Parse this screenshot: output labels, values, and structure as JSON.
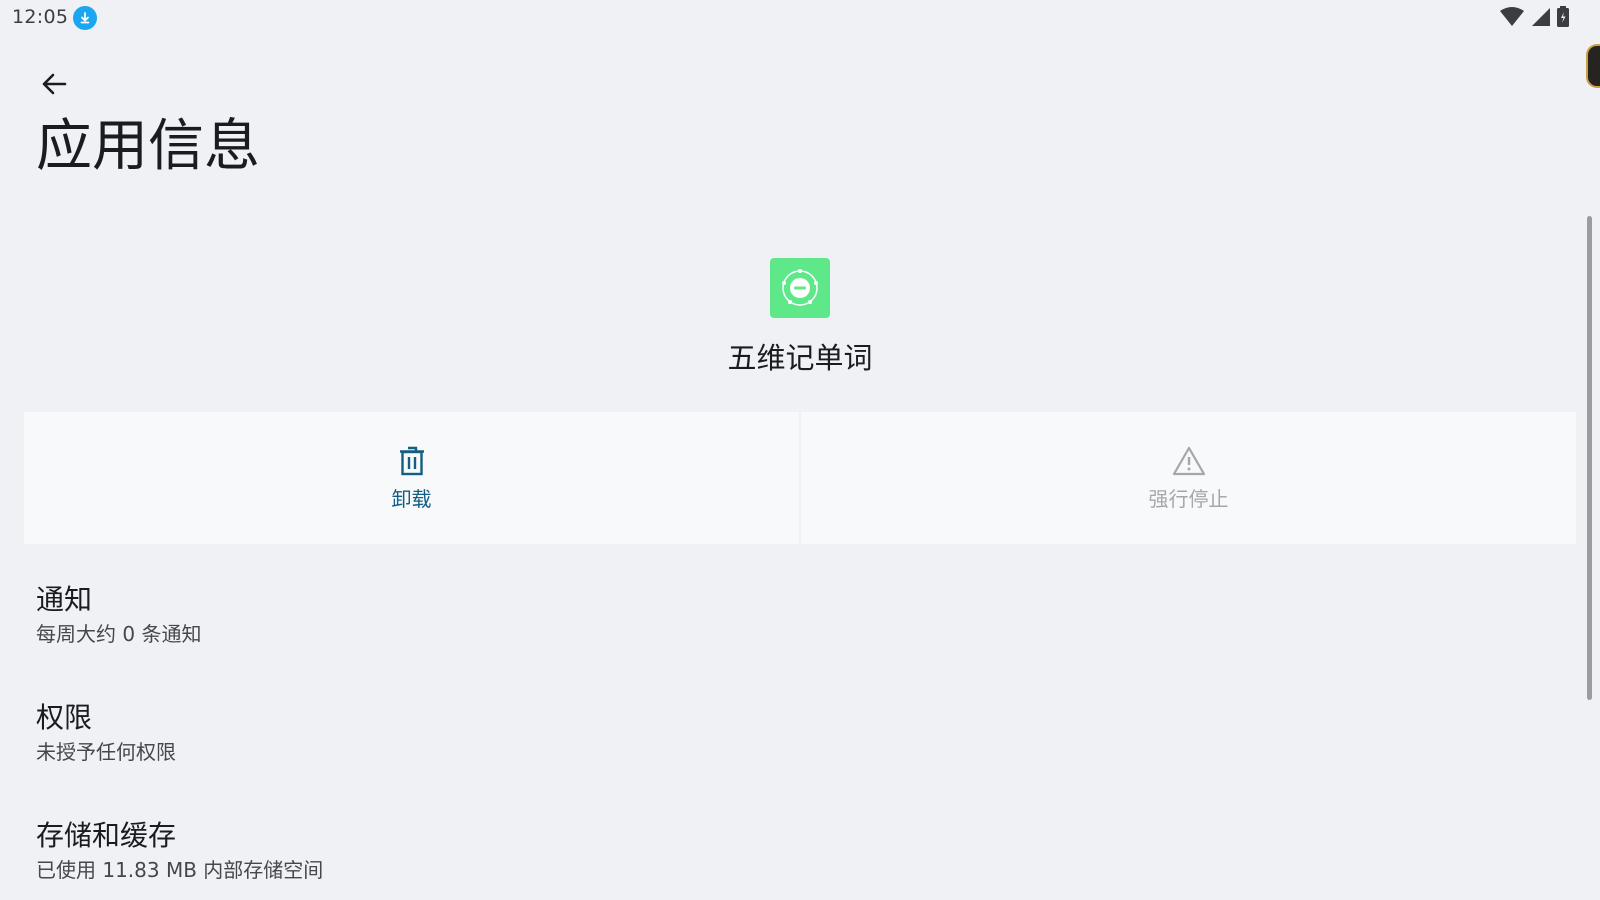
{
  "status_bar": {
    "time": "12:05",
    "icons": [
      "download-icon",
      "wifi-icon",
      "signal-icon",
      "battery-charging-icon"
    ]
  },
  "header": {
    "back_icon": "arrow-left-icon",
    "title": "应用信息"
  },
  "app": {
    "name": "五维记单词",
    "icon": "app-logo-icon",
    "icon_color": "#5fe88a"
  },
  "actions": {
    "uninstall": {
      "label": "卸载",
      "icon": "trash-icon",
      "color": "#135e83",
      "enabled": true
    },
    "force_stop": {
      "label": "强行停止",
      "icon": "warning-icon",
      "color": "#a4a7ab",
      "enabled": false
    }
  },
  "settings": {
    "notifications": {
      "title": "通知",
      "summary": "每周大约 0 条通知"
    },
    "permissions": {
      "title": "权限",
      "summary": "未授予任何权限"
    },
    "storage": {
      "title": "存储和缓存",
      "summary": "已使用 11.83 MB 内部存储空间"
    }
  },
  "colors": {
    "background": "#eff1f4",
    "accent": "#135e83",
    "download_badge": "#1aa6f0"
  }
}
